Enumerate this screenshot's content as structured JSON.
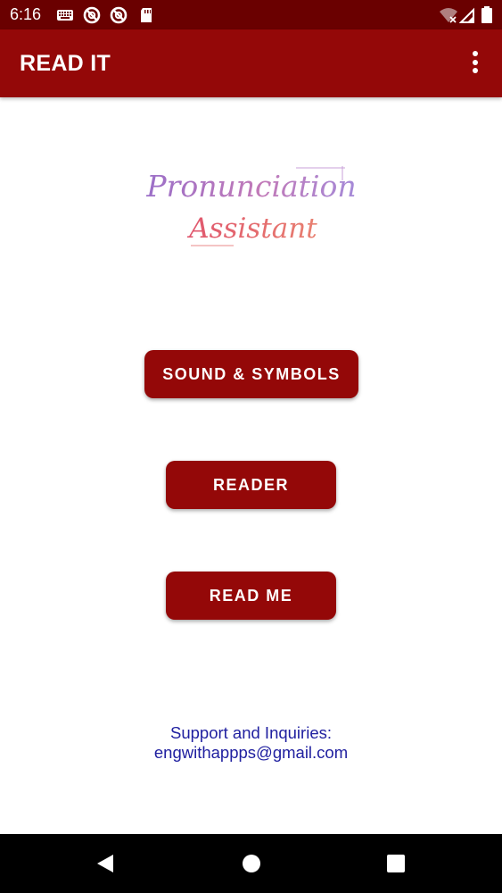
{
  "status_bar": {
    "time": "6:16",
    "icons_left": [
      "keyboard-icon",
      "blocked-notification-icon",
      "blocked-notification-icon-2",
      "sd-card-icon"
    ],
    "icons_right": [
      "wifi-off-icon",
      "signal-icon",
      "battery-icon"
    ]
  },
  "app_bar": {
    "title": "READ IT",
    "menu_icon": "more-vert-icon"
  },
  "logo": {
    "line1": "Pronunciation",
    "line2": "Assistant"
  },
  "buttons": {
    "sound_symbols": "SOUND & SYMBOLS",
    "reader": "READER",
    "read_me": "READ ME"
  },
  "support": {
    "label": "Support and Inquiries:",
    "email": "engwithappps@gmail.com"
  },
  "nav_bar": {
    "back_icon": "back-icon",
    "home_icon": "home-icon",
    "recents_icon": "recents-icon"
  },
  "colors": {
    "status_bar": "#6a0000",
    "app_bar": "#940808",
    "button": "#940808",
    "support_text": "#2020a0",
    "logo_line1": "#9b6fc8",
    "logo_line2": "#e0566e"
  }
}
